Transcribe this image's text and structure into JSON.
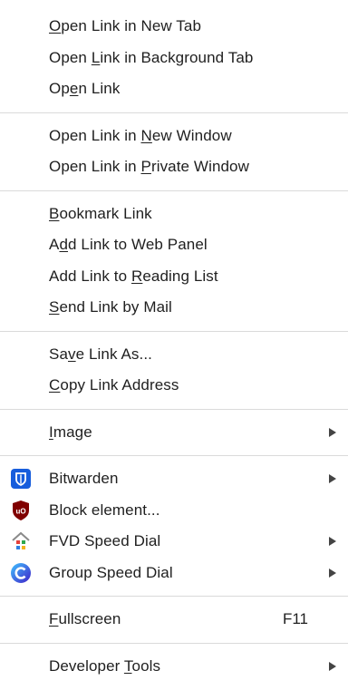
{
  "menu": {
    "groups": [
      [
        {
          "name": "open-link-new-tab",
          "pre": "",
          "acc": "O",
          "post": "pen Link in New Tab"
        },
        {
          "name": "open-link-background-tab",
          "pre": "Open ",
          "acc": "L",
          "post": "ink in Background Tab"
        },
        {
          "name": "open-link",
          "pre": "Op",
          "acc": "e",
          "post": "n Link"
        }
      ],
      [
        {
          "name": "open-link-new-window",
          "pre": "Open Link in ",
          "acc": "N",
          "post": "ew Window"
        },
        {
          "name": "open-link-private-window",
          "pre": "Open Link in ",
          "acc": "P",
          "post": "rivate Window"
        }
      ],
      [
        {
          "name": "bookmark-link",
          "pre": "",
          "acc": "B",
          "post": "ookmark Link"
        },
        {
          "name": "add-link-web-panel",
          "pre": "A",
          "acc": "d",
          "post": "d Link to Web Panel"
        },
        {
          "name": "add-link-reading-list",
          "pre": "Add Link to ",
          "acc": "R",
          "post": "eading List"
        },
        {
          "name": "send-link-by-mail",
          "pre": "",
          "acc": "S",
          "post": "end Link by Mail"
        }
      ],
      [
        {
          "name": "save-link-as",
          "pre": "Sa",
          "acc": "v",
          "post": "e Link As..."
        },
        {
          "name": "copy-link-address",
          "pre": "",
          "acc": "C",
          "post": "opy Link Address"
        }
      ],
      [
        {
          "name": "image",
          "pre": "",
          "acc": "I",
          "post": "mage",
          "submenu": true
        }
      ],
      [
        {
          "name": "bitwarden",
          "pre": "Bitwarden",
          "acc": "",
          "post": "",
          "submenu": true,
          "icon": "bitwarden-icon"
        },
        {
          "name": "block-element",
          "pre": "Block element...",
          "acc": "",
          "post": "",
          "icon": "ublock-icon"
        },
        {
          "name": "fvd-speed-dial",
          "pre": "FVD Speed Dial",
          "acc": "",
          "post": "",
          "submenu": true,
          "icon": "fvd-speed-dial-icon"
        },
        {
          "name": "group-speed-dial",
          "pre": "Group Speed Dial",
          "acc": "",
          "post": "",
          "submenu": true,
          "icon": "group-speed-dial-icon"
        }
      ],
      [
        {
          "name": "fullscreen",
          "pre": "",
          "acc": "F",
          "post": "ullscreen",
          "shortcut": "F11"
        }
      ],
      [
        {
          "name": "developer-tools",
          "pre": "Developer ",
          "acc": "T",
          "post": "ools",
          "submenu": true
        }
      ]
    ],
    "colors": {
      "text": "#1f1f1f",
      "separator": "#dadada",
      "arrow": "#444444",
      "bitwarden": "#175ddc",
      "ublock": "#800000"
    }
  }
}
